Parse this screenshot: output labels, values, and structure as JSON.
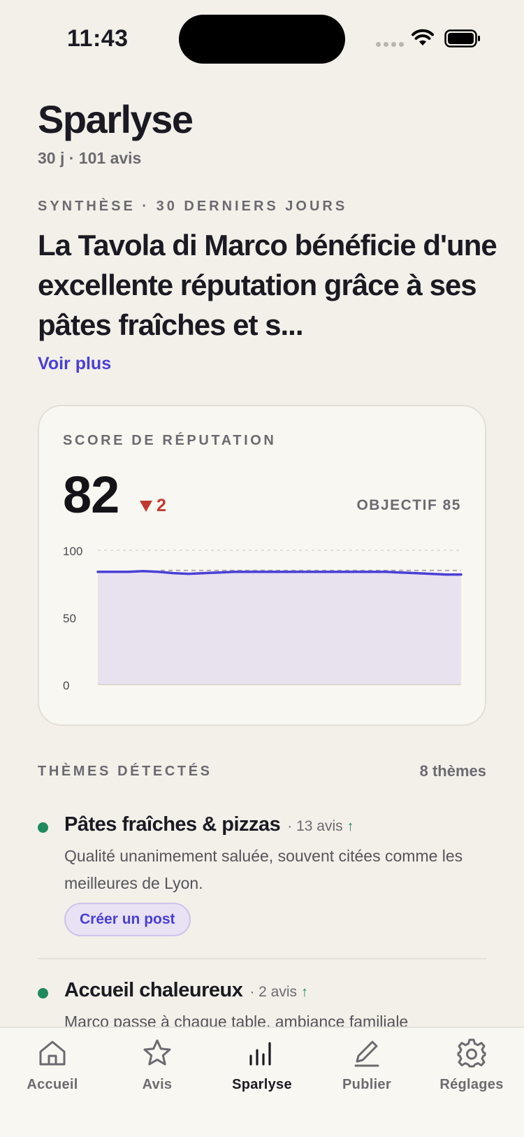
{
  "status": {
    "time": "11:43"
  },
  "header": {
    "title": "Sparlyse",
    "subtitle": "30 j · 101 avis"
  },
  "summary": {
    "kicker": "SYNTHÈSE · 30 DERNIERS JOURS",
    "text": "La Tavola di Marco bénéficie d'une excellente réputation grâce à ses pâtes fraîches et s...",
    "see_more": "Voir plus"
  },
  "score_card": {
    "label": "SCORE DE RÉPUTATION",
    "score": "82",
    "delta": "2",
    "delta_direction": "down",
    "target": "OBJECTIF 85",
    "colors": {
      "line": "#4a3fd6",
      "fill": "#e8e2ef",
      "target_line": "#a9a6ad",
      "delta": "#c2392f"
    }
  },
  "chart_data": {
    "type": "area",
    "ylim": [
      0,
      100
    ],
    "y_ticks": [
      "100",
      "50",
      "0"
    ],
    "y_tick_values": [
      100,
      50,
      0
    ],
    "target": 85,
    "values": [
      84,
      84,
      84,
      84.5,
      84,
      83,
      82.5,
      83,
      83.5,
      84,
      84,
      84,
      84,
      84,
      84,
      84,
      84,
      84,
      84,
      84,
      83.5,
      83,
      82.5,
      82,
      82
    ]
  },
  "themes": {
    "heading": "THÈMES DÉTECTÉS",
    "count": "8 thèmes",
    "items": [
      {
        "title": "Pâtes fraîches & pizzas",
        "meta": "· 13 avis",
        "trend": "↑",
        "description": "Qualité unanimement saluée, souvent citées comme les meilleures de Lyon.",
        "action": "Créer un post"
      },
      {
        "title": "Accueil chaleureux",
        "meta": "· 2 avis",
        "trend": "↑",
        "description": "Marco passe à chaque table, ambiance familiale"
      }
    ]
  },
  "tabs": [
    {
      "label": "Accueil",
      "icon": "home-icon"
    },
    {
      "label": "Avis",
      "icon": "star-icon"
    },
    {
      "label": "Sparlyse",
      "icon": "bar-chart-icon",
      "active": true
    },
    {
      "label": "Publier",
      "icon": "pen-icon"
    },
    {
      "label": "Réglages",
      "icon": "gear-icon"
    }
  ]
}
